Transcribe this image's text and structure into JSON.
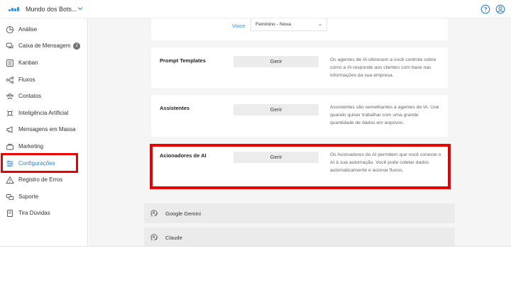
{
  "topbar": {
    "workspace": "Mundo dos Bots...",
    "icons": [
      "logo-icon",
      "chevron-down-icon",
      "help-icon",
      "user-icon"
    ]
  },
  "sidebar": {
    "items": [
      {
        "label": "Análise",
        "icon": "chart-pie-icon"
      },
      {
        "label": "Caixa de Mensagem",
        "icon": "chat-icon",
        "badge": "2"
      },
      {
        "label": "Kanban",
        "icon": "kanban-icon"
      },
      {
        "label": "Fluxos",
        "icon": "flow-icon"
      },
      {
        "label": "Contatos",
        "icon": "contacts-icon"
      },
      {
        "label": "Inteligência Artificial",
        "icon": "ai-icon"
      },
      {
        "label": "Mensagens em Massa",
        "icon": "megaphone-icon"
      },
      {
        "label": "Marketing",
        "icon": "marketing-icon"
      },
      {
        "label": "Configurações",
        "icon": "settings-sliders-icon",
        "active": true
      },
      {
        "label": "Registro de Erros",
        "icon": "warning-icon"
      },
      {
        "label": "Suporte",
        "icon": "support-icon"
      },
      {
        "label": "Tira Dúvidas",
        "icon": "book-icon"
      }
    ]
  },
  "voice": {
    "label": "Voice",
    "value": "Feminino - Nova"
  },
  "cards": [
    {
      "title": "Prompt Templates",
      "button": "Gerir",
      "description": "Os agentes de IA oferecem a você controle sobre como a IA responde aos clientes com base nas informações da sua empresa."
    },
    {
      "title": "Assistentes",
      "button": "Gerir",
      "description": "Assistentes são semelhantes a agentes de IA. Use quando quiser trabalhar com uma grande quantidade de dados em arquivos."
    },
    {
      "title": "Acionadores de AI",
      "button": "Gerir",
      "description": "Os Acionadores do AI permitem que você conecte o AI à sua automação. Você pode coletar dados automaticamente e acionar fluxos."
    }
  ],
  "providers": [
    {
      "label": "Google Gemini",
      "icon": "ai-head-icon"
    },
    {
      "label": "Claude",
      "icon": "ai-head-icon"
    }
  ],
  "colors": {
    "accent": "#2f7fd8",
    "highlight": "#ea0000",
    "badge": "#707070"
  }
}
